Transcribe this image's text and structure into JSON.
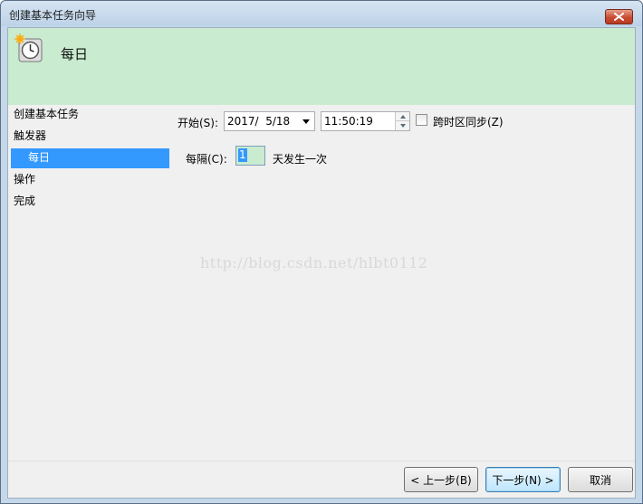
{
  "window": {
    "title": "创建基本任务向导"
  },
  "header": {
    "title": "每日",
    "icon": "clock-icon"
  },
  "nav": {
    "items": [
      {
        "label": "创建基本任务"
      },
      {
        "label": "触发器"
      },
      {
        "label": "每日",
        "selected": true
      },
      {
        "label": "操作"
      },
      {
        "label": "完成"
      }
    ]
  },
  "form": {
    "start_label": "开始(S):",
    "date_value": "2017/  5/18",
    "time_value": "11:50:19",
    "sync_label": "跨时区同步(Z)",
    "sync_checked": false,
    "every_label": "每隔(C):",
    "interval_value": "1",
    "interval_suffix": "天发生一次"
  },
  "watermark": "http://blog.csdn.net/hlbt0112",
  "buttons": {
    "back": "< 上一步(B)",
    "next": "下一步(N) >",
    "cancel": "取消"
  },
  "colors": {
    "header_bg": "#c9ebcf",
    "selection": "#3399ff",
    "close_button": "#c94b31"
  }
}
